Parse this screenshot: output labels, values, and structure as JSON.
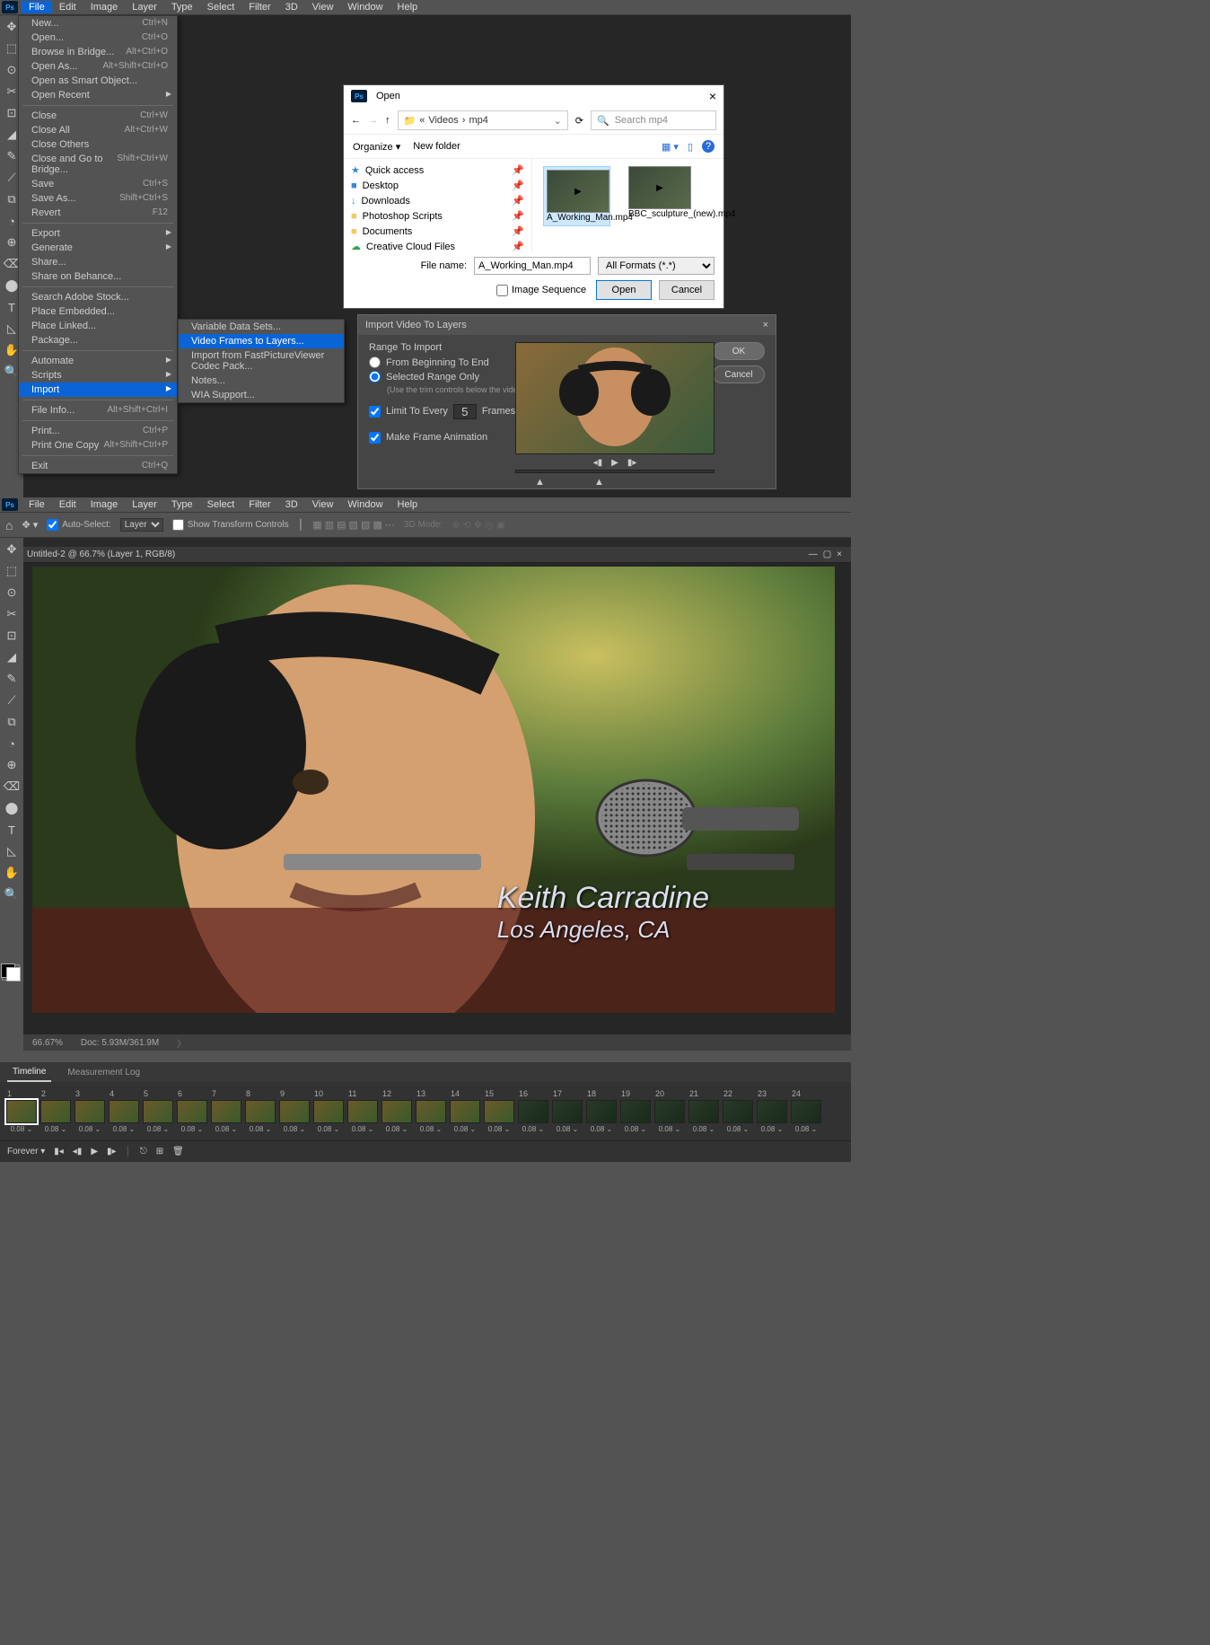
{
  "menu": {
    "items": [
      "File",
      "Edit",
      "Image",
      "Layer",
      "Type",
      "Select",
      "Filter",
      "3D",
      "View",
      "Window",
      "Help"
    ]
  },
  "file_menu": [
    {
      "label": "New...",
      "kb": "Ctrl+N"
    },
    {
      "label": "Open...",
      "kb": "Ctrl+O"
    },
    {
      "label": "Browse in Bridge...",
      "kb": "Alt+Ctrl+O"
    },
    {
      "label": "Open As...",
      "kb": "Alt+Shift+Ctrl+O"
    },
    {
      "label": "Open as Smart Object..."
    },
    {
      "label": "Open Recent",
      "sub": true
    },
    {
      "sep": true
    },
    {
      "label": "Close",
      "kb": "Ctrl+W"
    },
    {
      "label": "Close All",
      "kb": "Alt+Ctrl+W"
    },
    {
      "label": "Close Others"
    },
    {
      "label": "Close and Go to Bridge...",
      "kb": "Shift+Ctrl+W"
    },
    {
      "label": "Save",
      "kb": "Ctrl+S"
    },
    {
      "label": "Save As...",
      "kb": "Shift+Ctrl+S"
    },
    {
      "label": "Revert",
      "kb": "F12"
    },
    {
      "sep": true
    },
    {
      "label": "Export",
      "sub": true
    },
    {
      "label": "Generate",
      "sub": true
    },
    {
      "label": "Share..."
    },
    {
      "label": "Share on Behance..."
    },
    {
      "sep": true
    },
    {
      "label": "Search Adobe Stock..."
    },
    {
      "label": "Place Embedded..."
    },
    {
      "label": "Place Linked..."
    },
    {
      "label": "Package..."
    },
    {
      "sep": true
    },
    {
      "label": "Automate",
      "sub": true
    },
    {
      "label": "Scripts",
      "sub": true
    },
    {
      "label": "Import",
      "sub": true,
      "hl": true
    },
    {
      "sep": true
    },
    {
      "label": "File Info...",
      "kb": "Alt+Shift+Ctrl+I"
    },
    {
      "sep": true
    },
    {
      "label": "Print...",
      "kb": "Ctrl+P"
    },
    {
      "label": "Print One Copy",
      "kb": "Alt+Shift+Ctrl+P"
    },
    {
      "sep": true
    },
    {
      "label": "Exit",
      "kb": "Ctrl+Q"
    }
  ],
  "import_sub": [
    {
      "label": "Variable Data Sets..."
    },
    {
      "label": "Video Frames to Layers...",
      "hl": true
    },
    {
      "label": "Import from FastPictureViewer Codec Pack..."
    },
    {
      "label": "Notes..."
    },
    {
      "label": "WIA Support..."
    }
  ],
  "open_dialog": {
    "title": "Open",
    "path_parts": [
      "«",
      "Videos",
      "mp4"
    ],
    "search_placeholder": "Search mp4",
    "organize": "Organize",
    "new_folder": "New folder",
    "sidebar": [
      {
        "icon": "★",
        "label": "Quick access",
        "color": "#3a87d6"
      },
      {
        "icon": "■",
        "label": "Desktop",
        "color": "#3a87d6"
      },
      {
        "icon": "↓",
        "label": "Downloads",
        "color": "#3a87d6"
      },
      {
        "icon": "■",
        "label": "Photoshop Scripts",
        "color": "#f6c85f"
      },
      {
        "icon": "■",
        "label": "Documents",
        "color": "#f6c85f"
      },
      {
        "icon": "☁",
        "label": "Creative Cloud Files",
        "color": "#2da44e"
      }
    ],
    "files": [
      {
        "name": "A_Working_Man.mp4",
        "sel": true
      },
      {
        "name": "BBC_sculpture_(new).mp4"
      }
    ],
    "file_name_label": "File name:",
    "file_name_value": "A_Working_Man.mp4",
    "filter": "All Formats (*.*)",
    "image_sequence": "Image Sequence",
    "open_btn": "Open",
    "cancel_btn": "Cancel"
  },
  "import_dialog": {
    "title": "Import Video To Layers",
    "range_title": "Range To Import",
    "opt_beginning": "From Beginning To End",
    "opt_selected": "Selected Range Only",
    "hint": "(Use the trim controls below the video to specify the range)",
    "limit_label": "Limit To Every",
    "limit_value": "5",
    "frames": "Frames",
    "make_anim": "Make Frame Animation",
    "ok": "OK",
    "cancel": "Cancel"
  },
  "doc": {
    "title": "Untitled-2 @ 66.7% (Layer 1, RGB/8)",
    "zoom": "66.67%",
    "doc_size": "Doc: 5.93M/361.9M",
    "caption1": "Keith Carradine",
    "caption2": "Los Angeles, CA",
    "auto_select": "Auto-Select:",
    "layer": "Layer",
    "show_transform": "Show Transform Controls",
    "mode_3d": "3D Mode:"
  },
  "timeline": {
    "tab1": "Timeline",
    "tab2": "Measurement Log",
    "loop": "Forever",
    "delay": "0.08",
    "count": 24
  }
}
